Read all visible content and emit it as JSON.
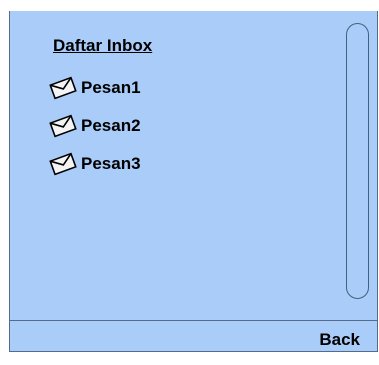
{
  "inbox": {
    "title": "Daftar Inbox",
    "messages": [
      {
        "label": "Pesan1",
        "icon": "envelope-icon"
      },
      {
        "label": "Pesan2",
        "icon": "envelope-icon"
      },
      {
        "label": "Pesan3",
        "icon": "envelope-icon"
      }
    ]
  },
  "softkeys": {
    "back_label": "Back"
  },
  "colors": {
    "screen_background": "#aaccf8",
    "border": "#556b8a",
    "text": "#000000"
  }
}
